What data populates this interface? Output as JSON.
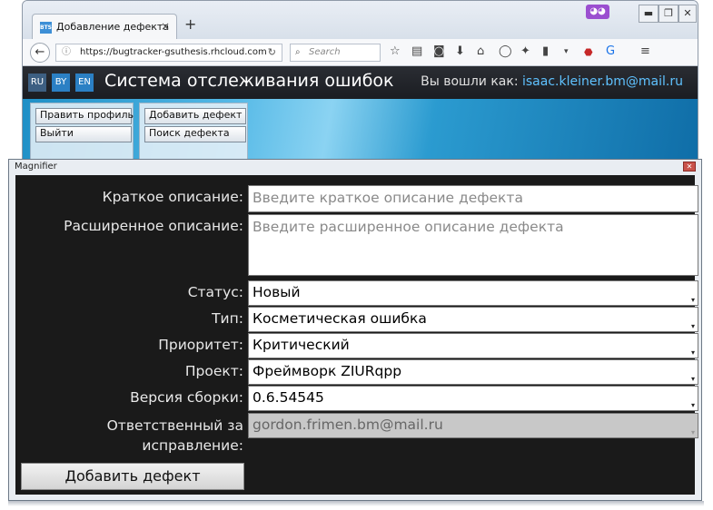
{
  "browser": {
    "tab_title": "Добавление дефекта",
    "tab_favicon": "BTS",
    "new_tab": "+",
    "close_tab": "×",
    "url": "https://bugtracker-gsuthesis.rhcloud.com",
    "search_placeholder": "Search",
    "window_controls": [
      "▬",
      "❐",
      "✕"
    ],
    "toolbar_icons": [
      "star-icon",
      "reading-list-icon",
      "pocket-icon",
      "download-icon",
      "home-icon",
      "chat-icon",
      "puzzle-icon",
      "clipboard-icon",
      "abp-icon",
      "google-translate-icon",
      "menu-icon"
    ]
  },
  "app": {
    "langs": [
      "RU",
      "BY",
      "EN"
    ],
    "title": "Система отслеживания ошибок",
    "logged_in_label": "Вы вошли как:",
    "logged_in_user": "isaac.kleiner.bm@mail.ru",
    "user_menu": [
      "Править профиль",
      "Выйти"
    ],
    "defect_menu": [
      "Добавить дефект",
      "Поиск дефекта"
    ],
    "colors": {
      "topbar": "#1f2126",
      "user_link": "#5fc2ff",
      "banner": "#2b9bd0"
    }
  },
  "magnifier": {
    "title": "Magnifier",
    "form": {
      "short_desc_label": "Краткое описание:",
      "short_desc_placeholder": "Введите краткое описание дефекта",
      "long_desc_label": "Расширенное описание:",
      "long_desc_placeholder": "Введите расширенное описание дефекта",
      "status_label": "Статус:",
      "status_value": "Новый",
      "type_label": "Тип:",
      "type_value": "Косметическая ошибка",
      "priority_label": "Приоритет:",
      "priority_value": "Критический",
      "project_label": "Проект:",
      "project_value": "Фреймворк ZIURqpp",
      "build_label": "Версия сборки:",
      "build_value": "0.6.54545",
      "assignee_label_1": "Ответственный за",
      "assignee_label_2": "исправление:",
      "assignee_value": "gordon.frimen.bm@mail.ru",
      "submit": "Добавить дефект"
    }
  }
}
